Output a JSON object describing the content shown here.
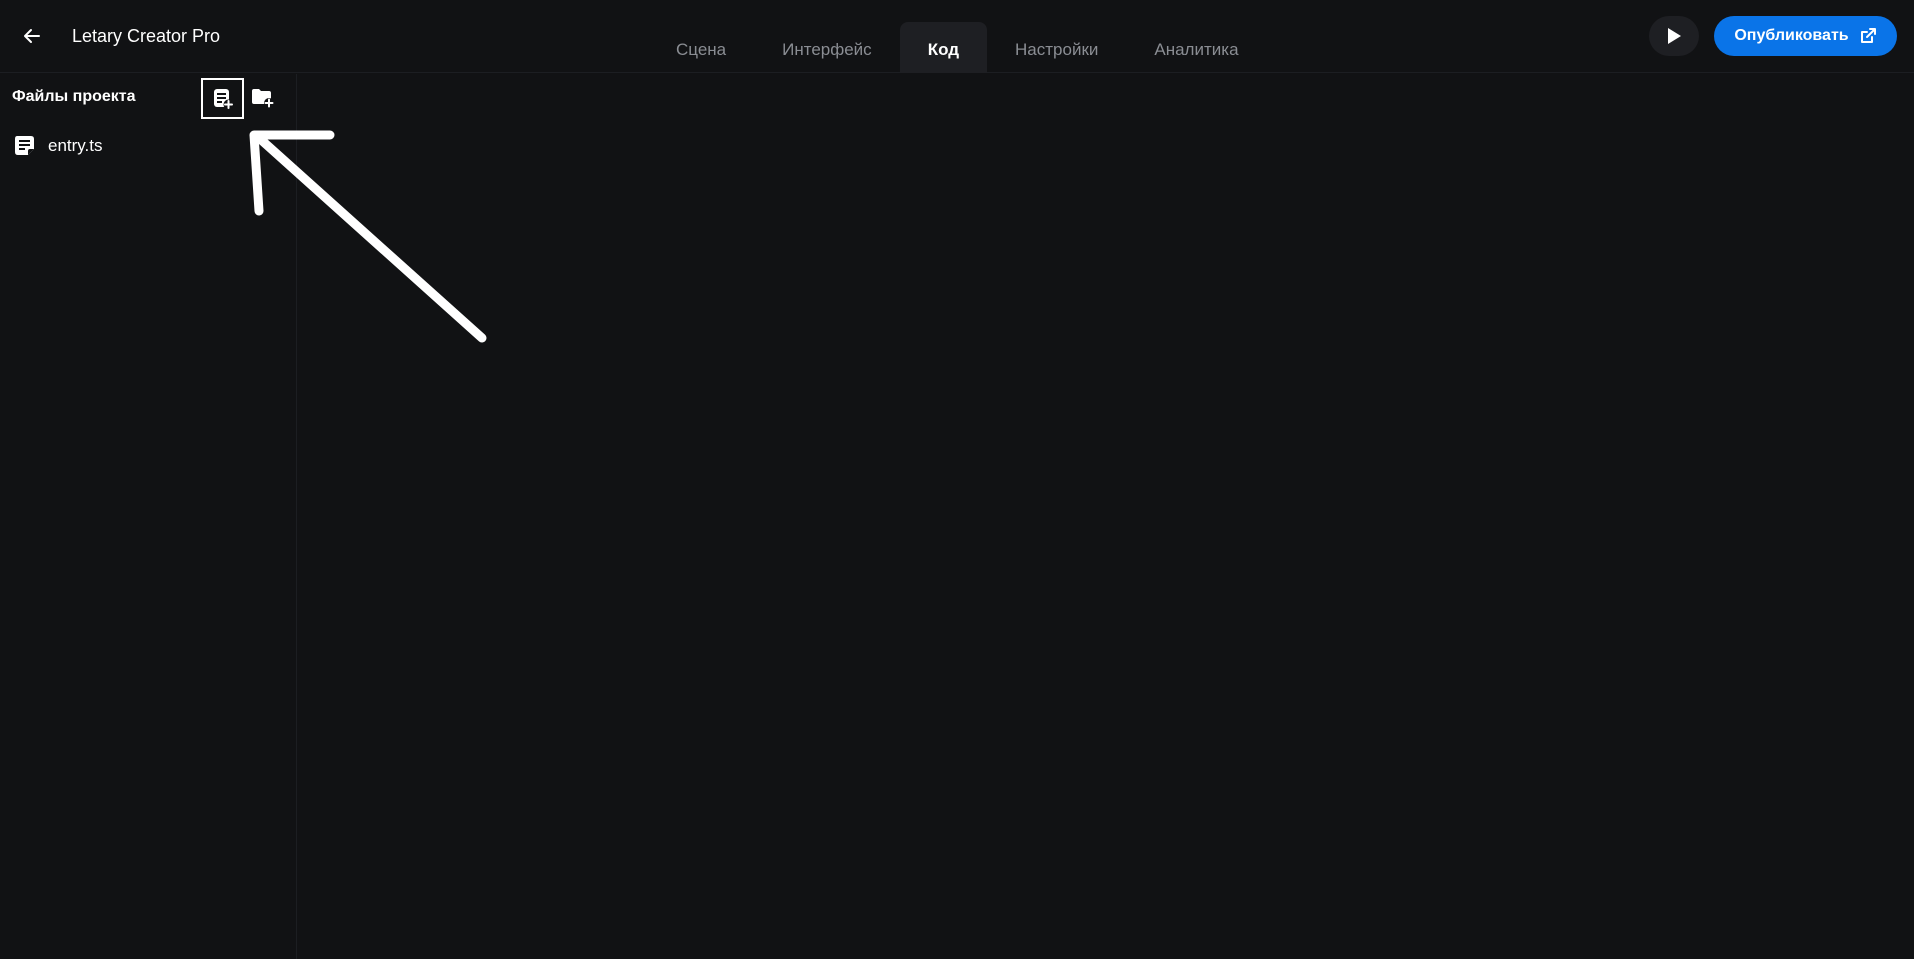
{
  "header": {
    "title": "Letary Creator Pro",
    "tabs": [
      {
        "label": "Сцена",
        "active": false
      },
      {
        "label": "Интерфейс",
        "active": false
      },
      {
        "label": "Код",
        "active": true
      },
      {
        "label": "Настройки",
        "active": false
      },
      {
        "label": "Аналитика",
        "active": false
      }
    ],
    "publish_label": "Опубликовать"
  },
  "sidebar": {
    "title": "Файлы проекта",
    "files": [
      {
        "name": "entry.ts",
        "icon": "file-text-icon"
      }
    ]
  },
  "colors": {
    "background": "#111214",
    "accent": "#0a74e8",
    "tab_active_bg": "#1e1f23",
    "tab_inactive_text": "#8a8d93"
  },
  "icons": {
    "back": "arrow-left-icon",
    "play": "play-icon",
    "publish": "external-link-icon",
    "new_file": "file-plus-icon",
    "new_folder": "folder-plus-icon"
  }
}
